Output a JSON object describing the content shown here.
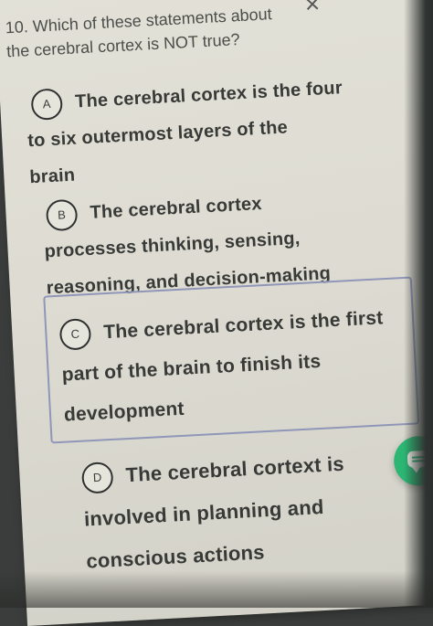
{
  "question": {
    "number": "10.",
    "line1": "Which of these statements about",
    "line2": "the cerebral cortex is NOT true?"
  },
  "close_icon": "close-icon",
  "options": [
    {
      "letter": "A",
      "lines": [
        "The cerebral cortex is the four",
        "to six outermost layers of the",
        "brain"
      ],
      "selected": false
    },
    {
      "letter": "B",
      "lines": [
        "The cerebral cortex",
        "processes thinking, sensing,",
        "reasoning, and decision-making"
      ],
      "selected": false
    },
    {
      "letter": "C",
      "lines": [
        "The cerebral cortex is the first",
        "part of the brain to finish its",
        "development"
      ],
      "selected": true
    },
    {
      "letter": "D",
      "lines": [
        "The cerebral cortext is",
        "involved in planning and",
        "conscious actions"
      ],
      "selected": false
    }
  ],
  "colors": {
    "selected_border": "#8f96b8",
    "feedback_button": "#2bb673"
  },
  "feedback_icon": "chat-bubble-icon"
}
